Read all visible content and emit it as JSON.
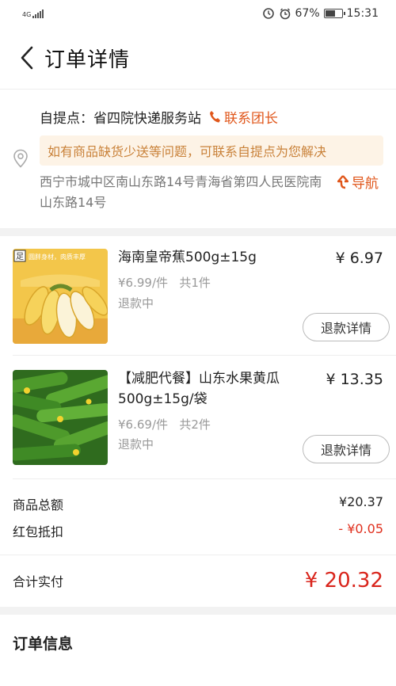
{
  "status_bar": {
    "network": "4G",
    "battery": "67%",
    "battery_level": 0.67,
    "time": "15:31"
  },
  "header": {
    "title": "订单详情"
  },
  "pickup": {
    "label": "自提点：",
    "name": "省四院快递服务站",
    "contact_label": "联系团长",
    "notice": "如有商品缺货少送等问题，可联系自提点为您解决",
    "address": "西宁市城中区南山东路14号青海省第四人民医院南山东路14号",
    "navigate_label": "导航"
  },
  "products": [
    {
      "name": "海南皇帝蕉500g±15g",
      "price": "¥ 6.97",
      "unit_price": "¥6.99/件",
      "quantity": "共1件",
      "status": "退款中",
      "refund_label": "退款详情",
      "image_tag": "圆胖身材，肉质丰厚"
    },
    {
      "name": "【减肥代餐】山东水果黄瓜500g±15g/袋",
      "price": "¥ 13.35",
      "unit_price": "¥6.69/件",
      "quantity": "共2件",
      "status": "退款中",
      "refund_label": "退款详情"
    }
  ],
  "summary": {
    "goods_total_label": "商品总额",
    "goods_total": "¥20.37",
    "coupon_label": "红包抵扣",
    "coupon": "- ¥0.05",
    "paid_label": "合计实付",
    "paid": "¥ 20.32"
  },
  "order_info": {
    "title": "订单信息"
  },
  "colors": {
    "accent_orange": "#e0561a",
    "price_red": "#d9251c",
    "notice_bg": "#fdf3e6"
  }
}
